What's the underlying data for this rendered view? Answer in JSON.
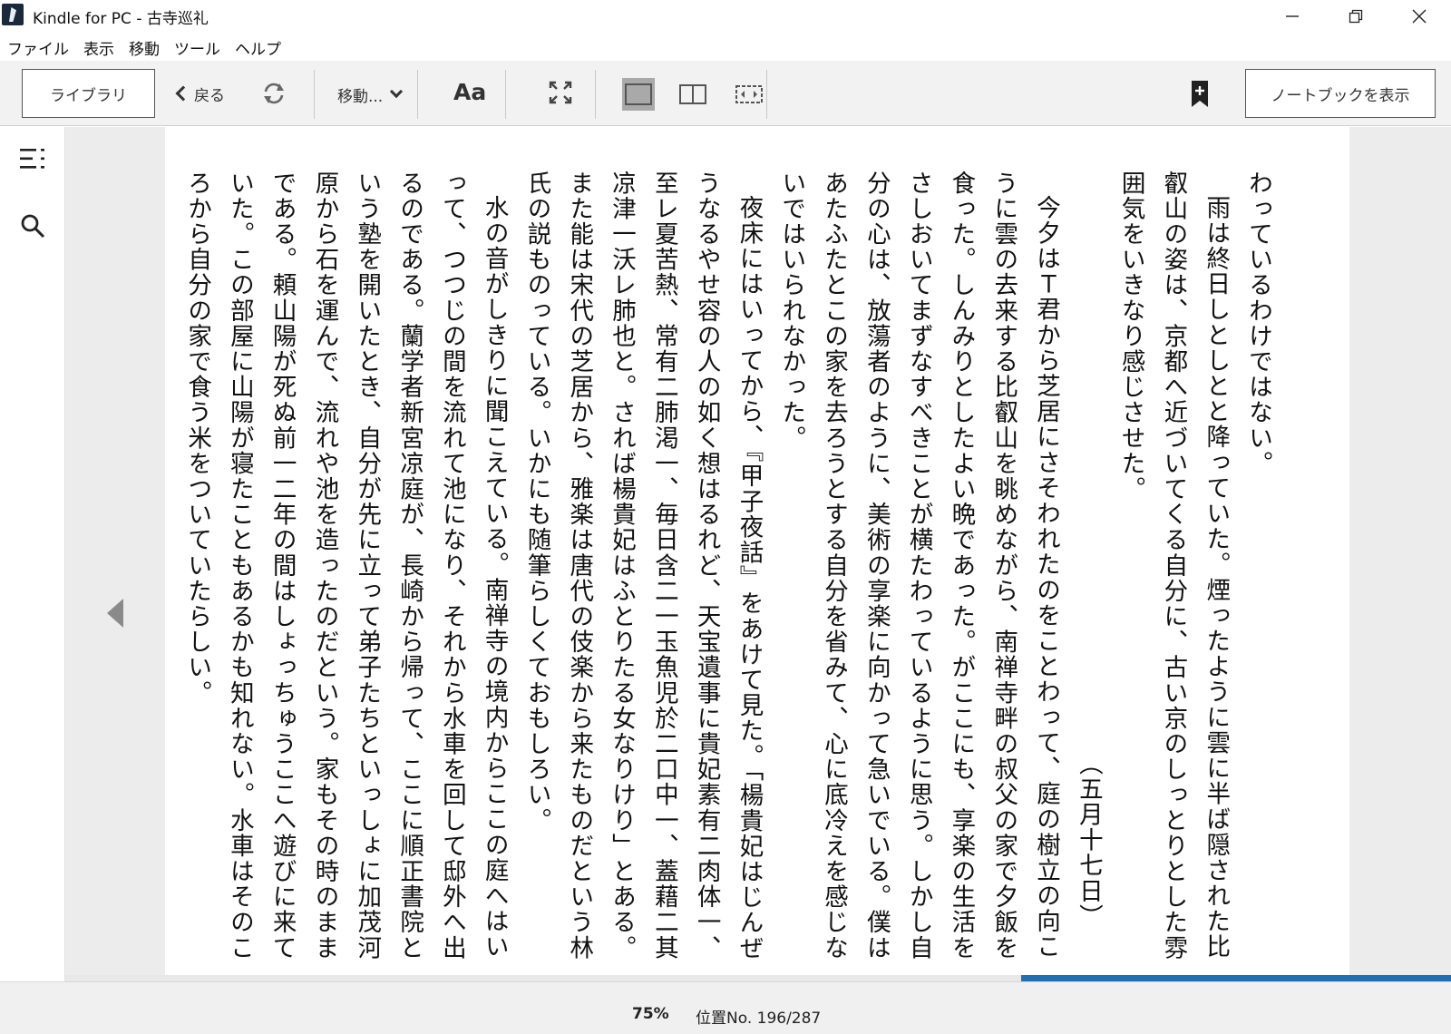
{
  "window": {
    "title": "Kindle for PC - 古寺巡礼",
    "minimize": "—",
    "maximize": "❐",
    "close": "✕"
  },
  "menu": [
    "ファイル",
    "表示",
    "移動",
    "ツール",
    "ヘルプ"
  ],
  "toolbar": {
    "library": "ライブラリ",
    "back": "戻る",
    "goto": "移動...",
    "font": "Aa",
    "notebook": "ノートブックを表示",
    "icons": {
      "sync": "sync-icon",
      "fullscreen": "fullscreen-icon",
      "single_page": "single-page-view-icon",
      "two_page": "two-page-view-icon",
      "scroll": "continuous-view-icon",
      "bookmark": "bookmark-icon"
    }
  },
  "sidebar": {
    "icons": [
      "toc-icon",
      "search-icon"
    ]
  },
  "book": {
    "paragraphs": [
      {
        "text": "わっているわけではない。",
        "indent": false
      },
      {
        "text": "雨は終日しとしとと降っていた。煙ったように雲に半ば隠された比叡山の姿は、京都へ近づいてくる自分に、古い京のしっとりとした雰囲気をいきなり感じさせた。",
        "indent": true
      },
      {
        "text": "（五月十七日）",
        "indent": false,
        "date": true
      },
      {
        "text": "今夕はＴ君から芝居にさそわれたのをことわって、庭の樹立の向こうに雲の去来する比叡山を眺めながら、南禅寺畔の叔父の家で夕飯を食った。しんみりとしたよい晩であった。がここにも、享楽の生活をさしおいてまずなすべきことが横たわっているように思う。しかし自分の心は、放蕩者のように、美術の享楽に向かって急いでいる。僕はあたふたとこの家を去ろうとする自分を省みて、心に底冷えを感じないではいられなかった。",
        "indent": true
      },
      {
        "text": "夜床にはいってから、『甲子夜話』をあけて見た。「楊貴妃はじんぜうなるやせ容の人の如く想はるれど、天宝遺事に貴妃素有二肉体一、至レ夏苦熱、常有二肺渇一、毎日含二一玉魚児於二口中一、蓋藉二其凉津一沃レ肺也と。されば楊貴妃はふとりたる女なりけり」とある。また能は宋代の芝居から、雅楽は唐代の伎楽から来たものだという林氏の説ものっている。いかにも随筆らしくておもしろい。",
        "indent": true
      },
      {
        "text": "水の音がしきりに聞こえている。南禅寺の境内からここの庭へはいって、つつじの間を流れて池になり、それから水車を回して邸外へ出るのである。蘭学者新宮凉庭が、長崎から帰って、ここに順正書院という塾を開いたとき、自分が先に立って弟子たちといっしょに加茂河原から石を運んで、流れや池を造ったのだという。家もその時のままである。頼山陽が死ぬ前一二年の間はしょっちゅうここへ遊びに来ていた。この部屋に山陽が寝たこともあるかも知れない。水車はそのころから自分の家で食う米をついていたらしい。",
        "indent": true
      }
    ]
  },
  "status": {
    "progress_label": "75%",
    "progress_fraction": 0.31,
    "location": "位置No. 196/287"
  },
  "colors": {
    "progress": "#1f6fb2",
    "reading_bg": "#ececec",
    "toolbar_bg": "#f2f2f2"
  }
}
